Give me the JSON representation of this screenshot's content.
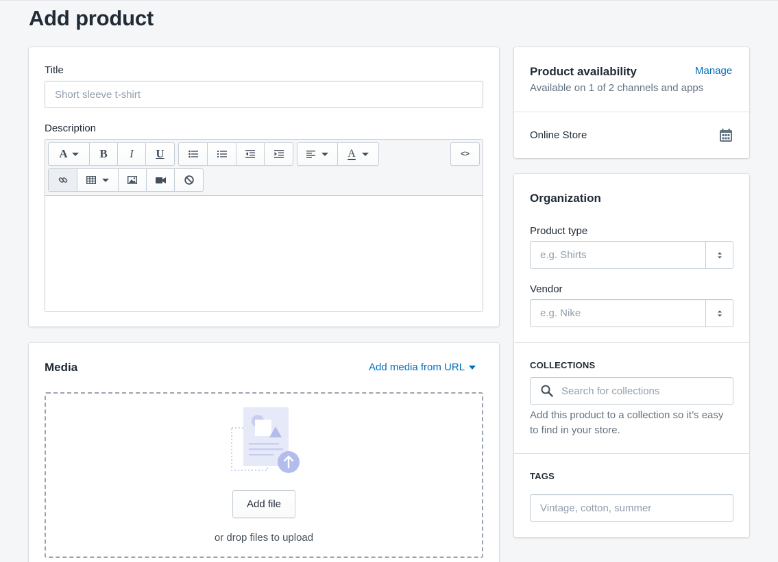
{
  "page": {
    "title": "Add product"
  },
  "product": {
    "title_label": "Title",
    "title_placeholder": "Short sleeve t-shirt",
    "description_label": "Description",
    "code_toggle_label": "<>"
  },
  "media": {
    "title": "Media",
    "add_from_url": "Add media from URL",
    "add_file_button": "Add file",
    "drop_hint": "or drop files to upload"
  },
  "availability": {
    "title": "Product availability",
    "manage_link": "Manage",
    "summary": "Available on 1 of 2 channels and apps",
    "channel": "Online Store"
  },
  "organization": {
    "title": "Organization",
    "product_type_label": "Product type",
    "product_type_placeholder": "e.g. Shirts",
    "vendor_label": "Vendor",
    "vendor_placeholder": "e.g. Nike",
    "collections_heading": "COLLECTIONS",
    "collections_placeholder": "Search for collections",
    "collections_help": "Add this product to a collection so it’s easy to find in your store.",
    "tags_heading": "TAGS",
    "tags_placeholder": "Vintage, cotton, summer"
  },
  "toolbar_icons": [
    "font-icon",
    "bold-icon",
    "italic-icon",
    "underline-icon",
    "bulleted-list-icon",
    "numbered-list-icon",
    "outdent-icon",
    "indent-icon",
    "align-icon",
    "text-color-icon",
    "code-icon",
    "link-icon",
    "table-icon",
    "image-icon",
    "video-icon",
    "clear-formatting-icon"
  ],
  "colors": {
    "accent": "#006fbb",
    "background": "#f4f6f8",
    "text": "#212b36",
    "subdued": "#637381"
  }
}
